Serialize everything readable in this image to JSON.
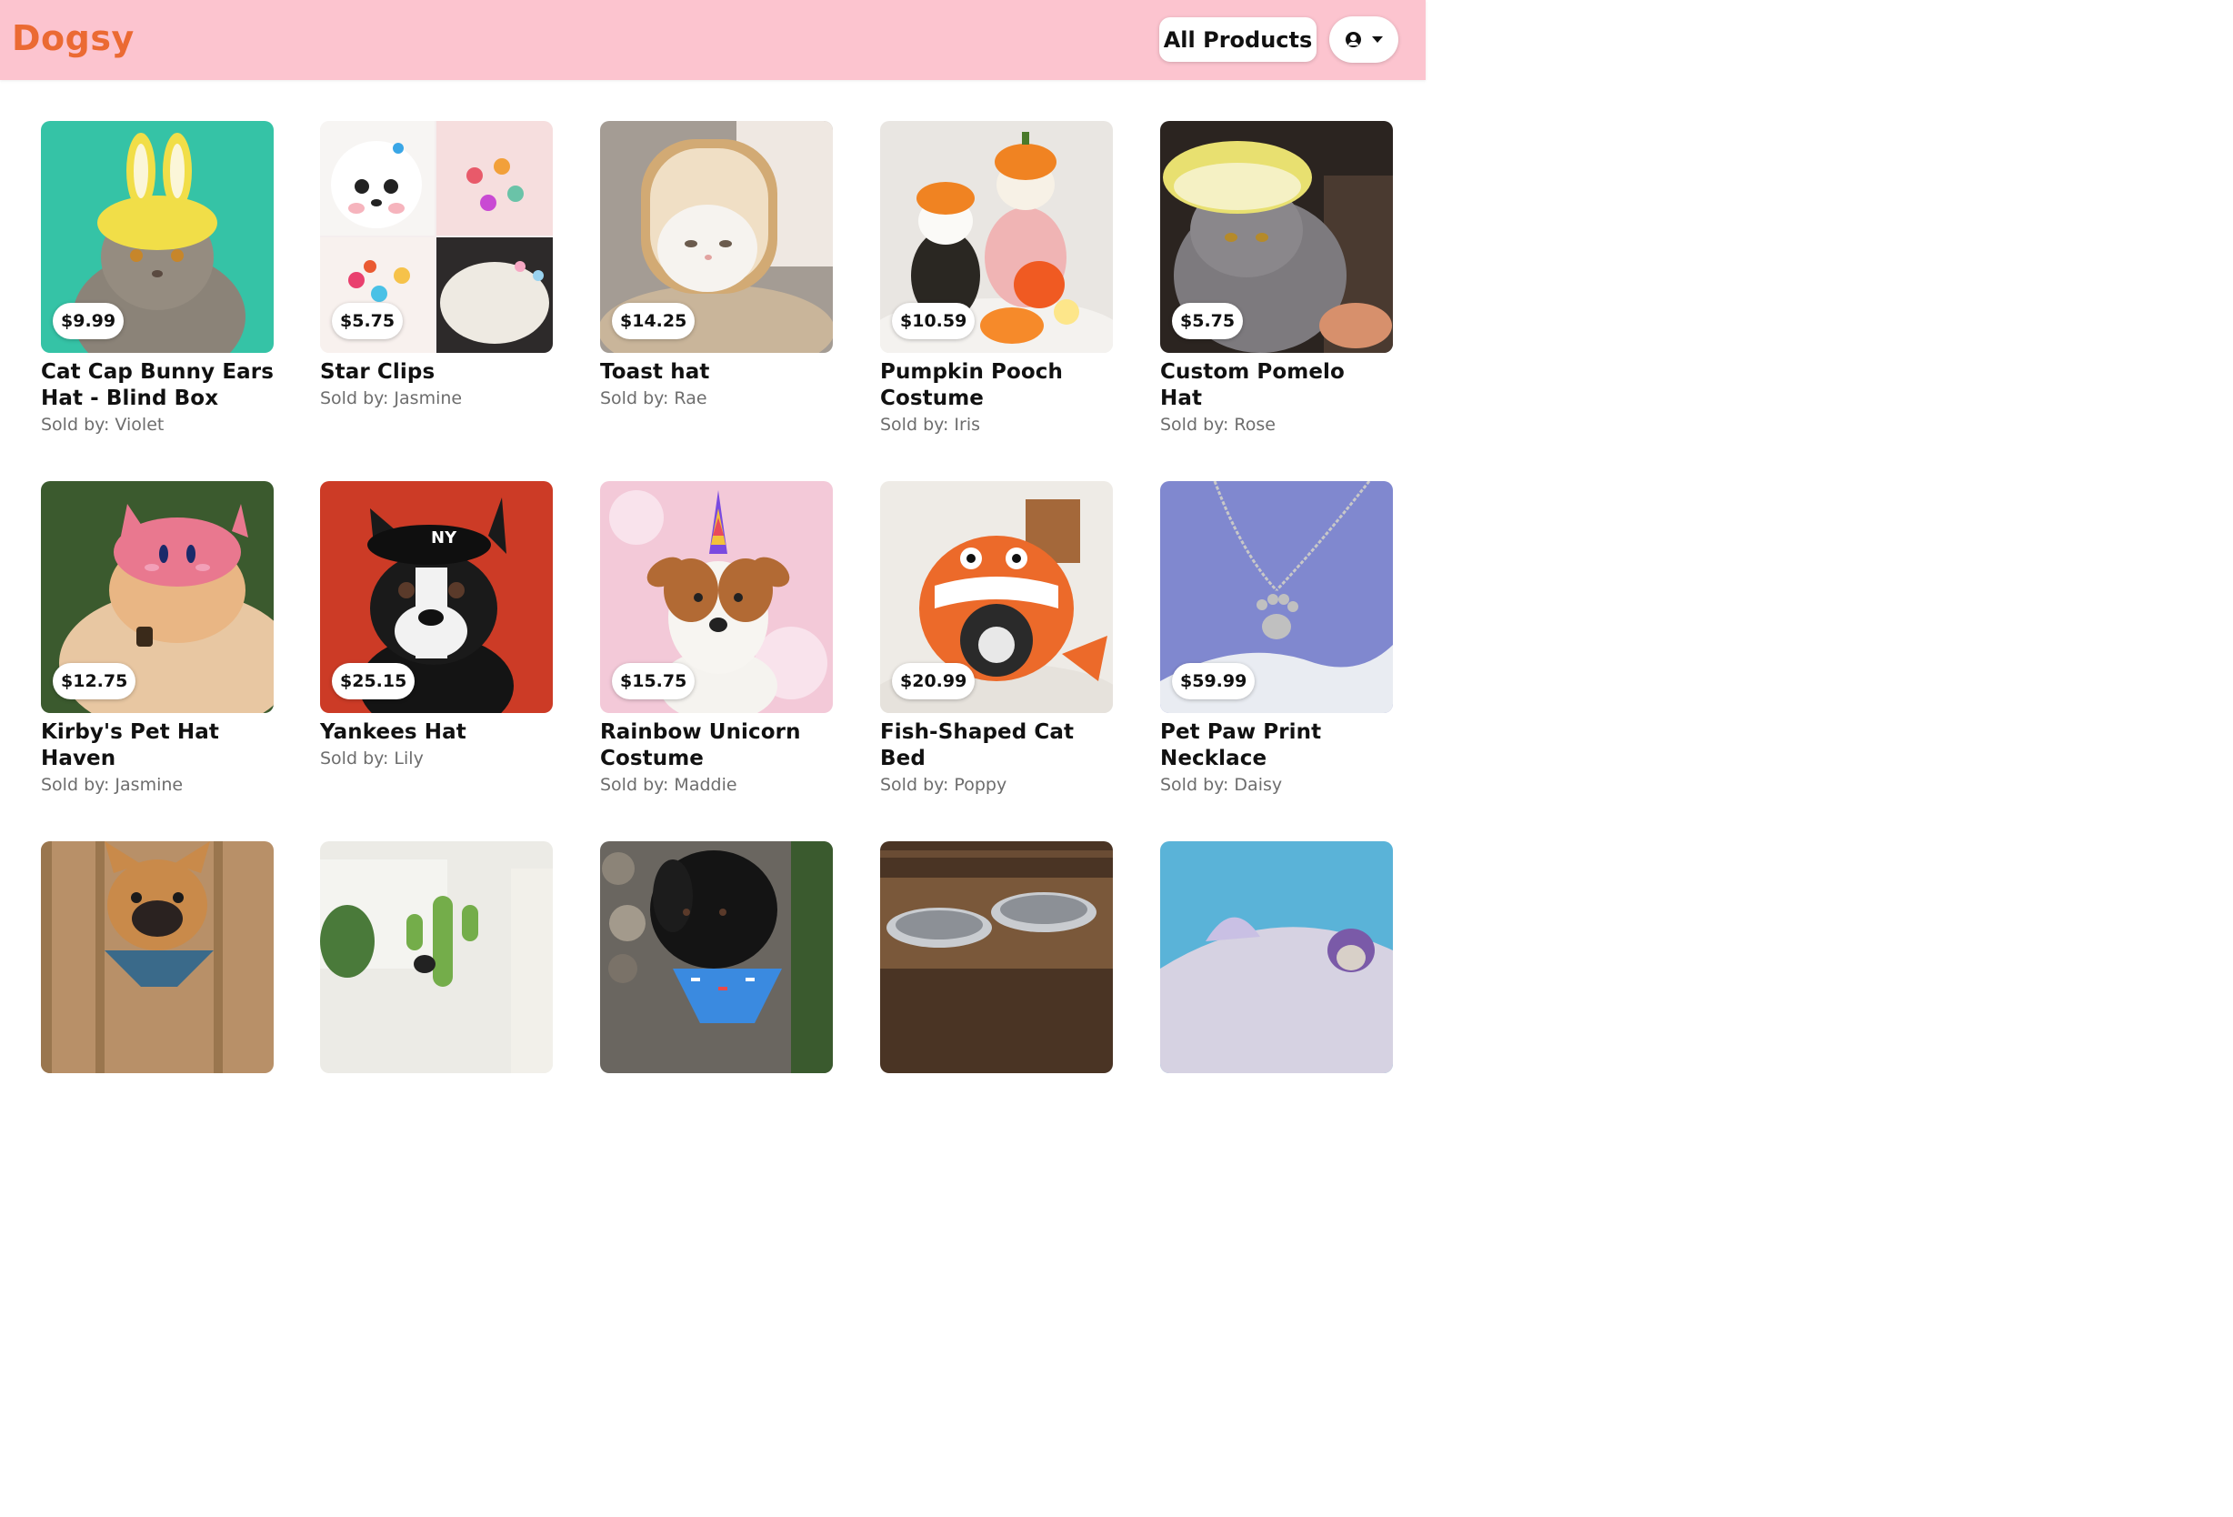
{
  "header": {
    "brand": "Dogsy",
    "all_products_label": "All Products",
    "brand_color": "#eb6a33",
    "background_color": "#fcc4cf"
  },
  "user_menu": {
    "icon": "user-circle-icon",
    "dropdown_icon": "caret-down-icon"
  },
  "products": [
    {
      "title": "Cat Cap Bunny Ears Hat - Blind Box",
      "price": "$9.99",
      "seller": "Sold by: Violet"
    },
    {
      "title": "Star Clips",
      "price": "$5.75",
      "seller": "Sold by: Jasmine"
    },
    {
      "title": "Toast hat",
      "price": "$14.25",
      "seller": "Sold by: Rae"
    },
    {
      "title": "Pumpkin Pooch Costume",
      "price": "$10.59",
      "seller": "Sold by: Iris"
    },
    {
      "title": "Custom Pomelo Hat",
      "price": "$5.75",
      "seller": "Sold by: Rose"
    },
    {
      "title": "Kirby's Pet Hat Haven",
      "price": "$12.75",
      "seller": "Sold by: Jasmine"
    },
    {
      "title": "Yankees Hat",
      "price": "$25.15",
      "seller": "Sold by: Lily"
    },
    {
      "title": "Rainbow Unicorn Costume",
      "price": "$15.75",
      "seller": "Sold by: Maddie"
    },
    {
      "title": "Fish-Shaped Cat Bed",
      "price": "$20.99",
      "seller": "Sold by: Poppy"
    },
    {
      "title": "Pet Paw Print Necklace",
      "price": "$59.99",
      "seller": "Sold by: Daisy"
    }
  ]
}
